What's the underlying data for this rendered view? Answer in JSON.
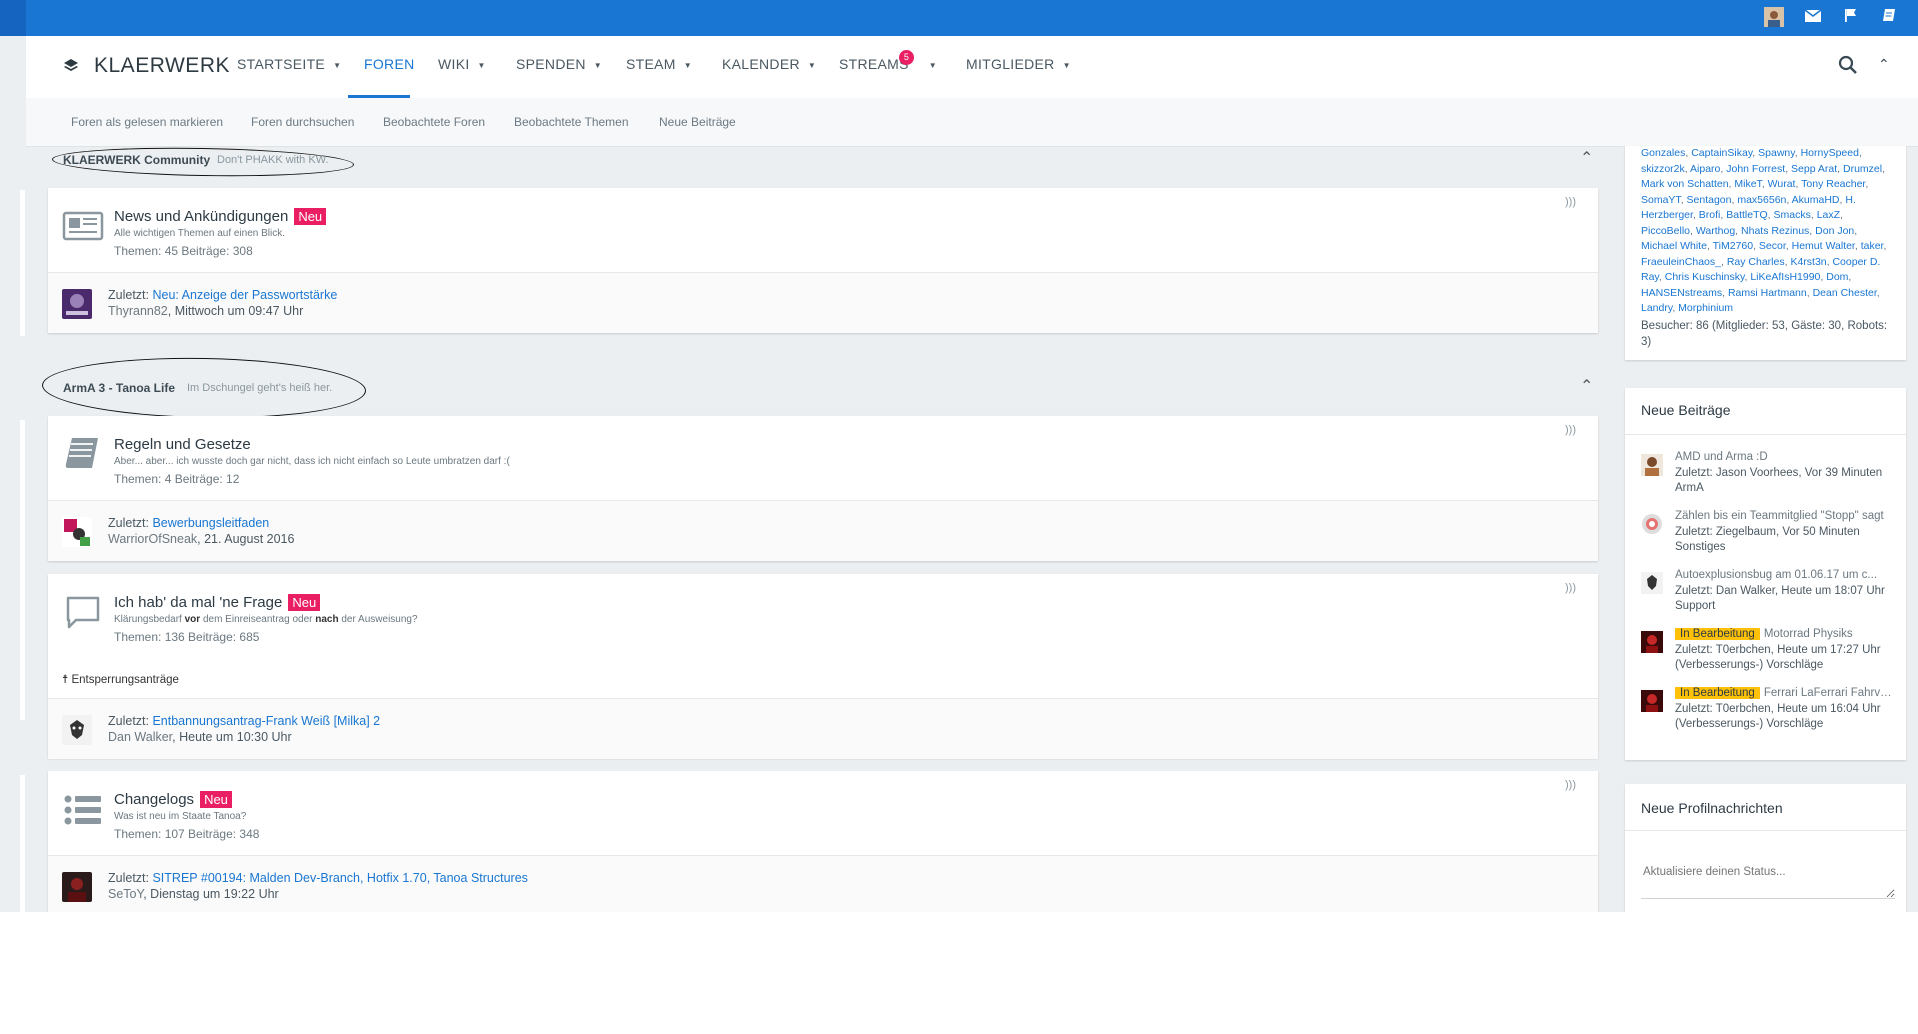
{
  "brand": {
    "name": "KLAERWERK"
  },
  "topbar_icons": [
    "avatar",
    "envelope-icon",
    "flag-icon",
    "notes-icon"
  ],
  "nav": {
    "items": [
      {
        "label": "STARTSEITE",
        "caret": true
      },
      {
        "label": "FOREN",
        "caret": false,
        "active": true
      },
      {
        "label": "WIKI",
        "caret": true
      },
      {
        "label": "SPENDEN",
        "caret": true
      },
      {
        "label": "STEAM",
        "caret": true
      },
      {
        "label": "KALENDER",
        "caret": true
      },
      {
        "label": "STREAMS",
        "caret": true,
        "badge": "5"
      },
      {
        "label": "MITGLIEDER",
        "caret": true
      }
    ]
  },
  "subnav": [
    "Foren als gelesen markieren",
    "Foren durchsuchen",
    "Beobachtete Foren",
    "Beobachtete Themen",
    "Neue Beiträge"
  ],
  "categories": [
    {
      "title": "KLAERWERK Community",
      "desc": "Don't PHAKK with KW.",
      "forums": [
        {
          "title": "News und Ankündigungen",
          "neu": "Neu",
          "desc": "Alle wichtigen Themen auf einen Blick.",
          "stats": "Themen: 45 Beiträge: 308",
          "last_prefix": "Zuletzt: ",
          "last_topic": "Neu: Anzeige der Passwortstärke",
          "last_user": "Thyrann82",
          "last_time": ", Mittwoch um 09:47 Uhr"
        }
      ]
    },
    {
      "title": "ArmA 3 - Tanoa Life",
      "desc": "Im Dschungel geht's heiß her.",
      "forums": [
        {
          "title": "Regeln und Gesetze",
          "neu": "",
          "desc": "Aber... aber... ich wusste doch gar nicht, dass ich nicht einfach so Leute umbratzen darf :(",
          "stats": "Themen: 4 Beiträge: 12",
          "last_prefix": "Zuletzt: ",
          "last_topic": "Bewerbungsleitfaden",
          "last_user": "WarriorOfSneak",
          "last_time": ", 21. August 2016"
        },
        {
          "title": "Ich hab' da mal 'ne Frage",
          "neu": "Neu",
          "desc_parts": [
            "Klärungsbedarf ",
            "vor",
            " dem Einreiseantrag oder ",
            "nach",
            " der Ausweisung?"
          ],
          "stats": "Themen: 136 Beiträge: 685",
          "subforum": "Entsperrungsanträge",
          "last_prefix": "Zuletzt: ",
          "last_topic": "Entbannungsantrag-Frank Weiß [Milka] 2",
          "last_user": "Dan Walker",
          "last_time": ", Heute um 10:30 Uhr"
        },
        {
          "title": "Changelogs",
          "neu": "Neu",
          "desc": "Was ist neu im Staate Tanoa?",
          "stats": "Themen: 107 Beiträge: 348",
          "last_prefix": "Zuletzt: ",
          "last_topic": "SITREP #00194: Malden Dev-Branch, Hotfix 1.70, Tanoa Structures",
          "last_user": "SeToY",
          "last_time": ", Dienstag um 19:22 Uhr"
        }
      ]
    }
  ],
  "online": {
    "users": [
      "Gonzales",
      "CaptainSikay",
      "Spawny",
      "HornySpeed",
      "skizzor2k",
      "Aiparo",
      "John Forrest",
      "Sepp Arat",
      "Drumzel",
      "Mark von Schatten",
      "MikeT",
      "Wurat",
      "Tony Reacher",
      "SomaYT",
      "Sentagon",
      "max5656n",
      "AkumaHD",
      "H. Herzberger",
      "Brofi",
      "BattleTQ",
      "Smacks",
      "LaxZ",
      "PiccoBello",
      "Warthog",
      "Nhats Rezinus",
      "Don Jon",
      "Michael White",
      "TiM2760",
      "Secor",
      "Hemut Walter",
      "taker",
      "FraeuleinChaos_",
      "Ray Charles",
      "K4rst3n",
      "Cooper D. Ray",
      "Chris Kuschinsky",
      "LiKeAfIsH1990",
      "Dom",
      "HANSENstreams",
      "Ramsi Hartmann",
      "Dean Chester",
      "Landry",
      "Morphinium"
    ],
    "visitors": "Besucher: 86 (Mitglieder: 53, Gäste: 30, Robots: 3)"
  },
  "neue_beitraege": {
    "title": "Neue Beiträge",
    "items": [
      {
        "tag": "",
        "title": "AMD und Arma :D",
        "meta": "Zuletzt: Jason Voorhees, Vor 39 Minuten",
        "forum": "ArmA"
      },
      {
        "tag": "",
        "title": "Zählen bis ein Teammitglied \"Stopp\" sagt",
        "meta": "Zuletzt: Ziegelbaum, Vor 50 Minuten",
        "forum": "Sonstiges"
      },
      {
        "tag": "",
        "title": "Autoexplusionsbug am 01.06.17 um c...",
        "meta": "Zuletzt: Dan Walker, Heute um 18:07 Uhr",
        "forum": "Support"
      },
      {
        "tag": "In Bearbeitung",
        "title": "Motorrad Physiks",
        "meta": "Zuletzt: T0erbchen, Heute um 17:27 Uhr",
        "forum": "(Verbesserungs-) Vorschläge"
      },
      {
        "tag": "In Bearbeitung",
        "title": "Ferrari LaFerrari Fahrverhalten",
        "meta": "Zuletzt: T0erbchen, Heute um 16:04 Uhr",
        "forum": "(Verbesserungs-) Vorschläge"
      }
    ]
  },
  "profil": {
    "title": "Neue Profilnachrichten",
    "placeholder": "Aktualisiere deinen Status..."
  }
}
